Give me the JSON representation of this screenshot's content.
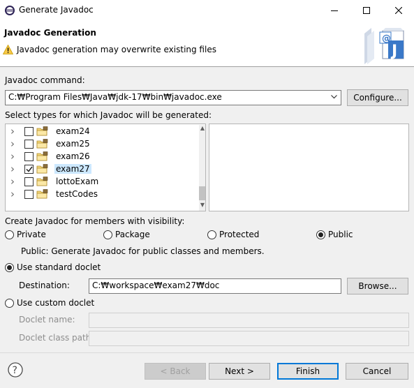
{
  "window": {
    "title": "Generate Javadoc"
  },
  "banner": {
    "title": "Javadoc Generation",
    "message": "Javadoc generation may overwrite existing files"
  },
  "javadoc_command": {
    "label": "Javadoc command:",
    "value": "C:₩Program Files₩Java₩jdk-17₩bin₩javadoc.exe",
    "configure_label": "Configure..."
  },
  "types": {
    "label": "Select types for which Javadoc will be generated:",
    "items": [
      {
        "name": "exam24",
        "checked": false,
        "selected": false
      },
      {
        "name": "exam25",
        "checked": false,
        "selected": false
      },
      {
        "name": "exam26",
        "checked": false,
        "selected": false
      },
      {
        "name": "exam27",
        "checked": true,
        "selected": true
      },
      {
        "name": "lottoExam",
        "checked": false,
        "selected": false
      },
      {
        "name": "testCodes",
        "checked": false,
        "selected": false
      }
    ]
  },
  "visibility": {
    "label": "Create Javadoc for members with visibility:",
    "options": [
      "Private",
      "Package",
      "Protected",
      "Public"
    ],
    "selected": "Public",
    "description": "Public: Generate Javadoc for public classes and members."
  },
  "standard_doclet": {
    "label": "Use standard doclet",
    "selected": true,
    "destination_label": "Destination:",
    "destination_value": "C:₩workspace₩exam27₩doc",
    "browse_label": "Browse..."
  },
  "custom_doclet": {
    "label": "Use custom doclet",
    "selected": false,
    "name_label": "Doclet name:",
    "classpath_label": "Doclet class path:"
  },
  "footer": {
    "back_label": "< Back",
    "next_label": "Next >",
    "finish_label": "Finish",
    "cancel_label": "Cancel"
  }
}
